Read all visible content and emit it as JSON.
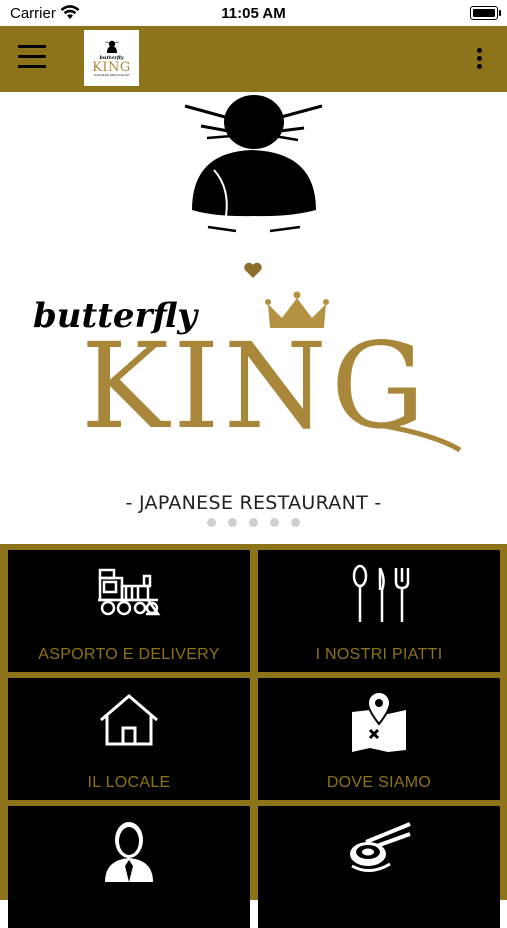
{
  "status_bar": {
    "carrier": "Carrier",
    "time": "11:05 AM"
  },
  "app_bar": {
    "logo_small": {
      "script": "butterfly",
      "name": "KING",
      "sub": "JAPANESE RESTAURANT"
    }
  },
  "hero": {
    "brand_script": "butterfly",
    "brand_name": "KING",
    "subtitle": "- JAPANESE RESTAURANT -",
    "slide_count": 5
  },
  "tiles": [
    {
      "label": "ASPORTO E DELIVERY",
      "icon": "train-icon"
    },
    {
      "label": "I NOSTRI PIATTI",
      "icon": "cutlery-icon"
    },
    {
      "label": "IL LOCALE",
      "icon": "house-icon"
    },
    {
      "label": "DOVE SIAMO",
      "icon": "map-pin-icon"
    },
    {
      "label": "",
      "icon": "person-icon"
    },
    {
      "label": "",
      "icon": "sushi-chopsticks-icon"
    }
  ],
  "colors": {
    "gold": "#8d7319",
    "logo_gold": "#a8873a",
    "tile_bg": "#000000"
  }
}
